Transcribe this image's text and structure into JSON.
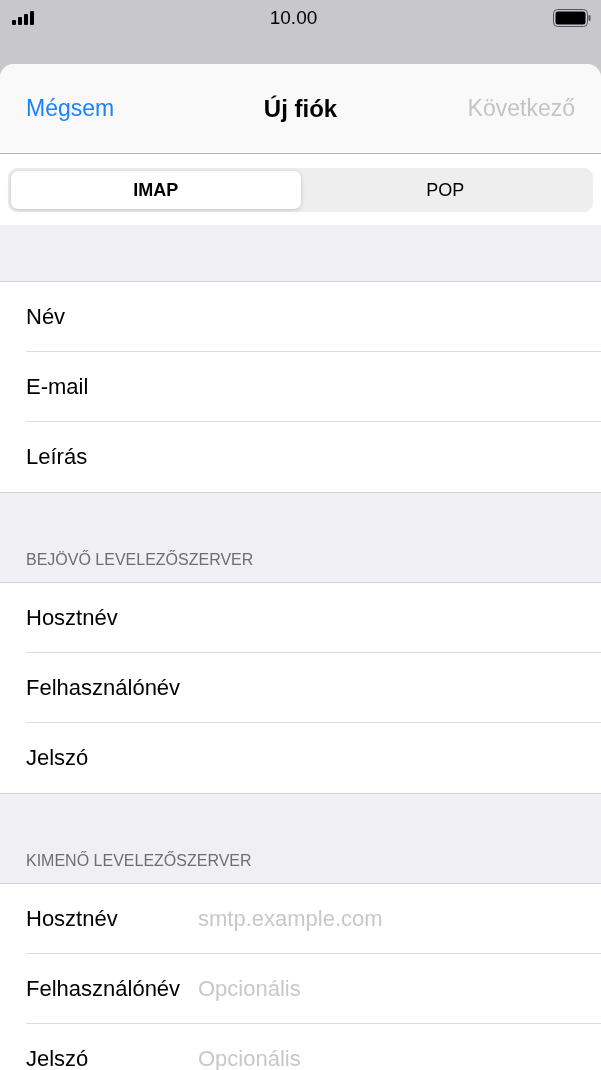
{
  "status_bar": {
    "time": "10.00"
  },
  "sheet": {
    "cancel": "Mégsem",
    "title": "Új fiók",
    "next": {
      "label": "Következő",
      "disabled": true
    }
  },
  "segments": [
    {
      "label": "IMAP",
      "selected": true
    },
    {
      "label": "POP",
      "selected": false
    }
  ],
  "sections": [
    {
      "fields": [
        {
          "label": "Név"
        },
        {
          "label": "E-mail"
        },
        {
          "label": "Leírás"
        }
      ]
    },
    {
      "header": "BEJÖVŐ LEVELEZŐSZERVER",
      "fields": [
        {
          "label": "Hosztnév"
        },
        {
          "label": "Felhasználónév"
        },
        {
          "label": "Jelszó"
        }
      ]
    },
    {
      "header": "KIMENŐ LEVELEZŐSZERVER",
      "fields": [
        {
          "label": "Hosztnév",
          "placeholder": "smtp.example.com"
        },
        {
          "label": "Felhasználónév",
          "placeholder": "Opcionális"
        },
        {
          "label": "Jelszó",
          "placeholder": "Opcionális"
        }
      ]
    }
  ]
}
